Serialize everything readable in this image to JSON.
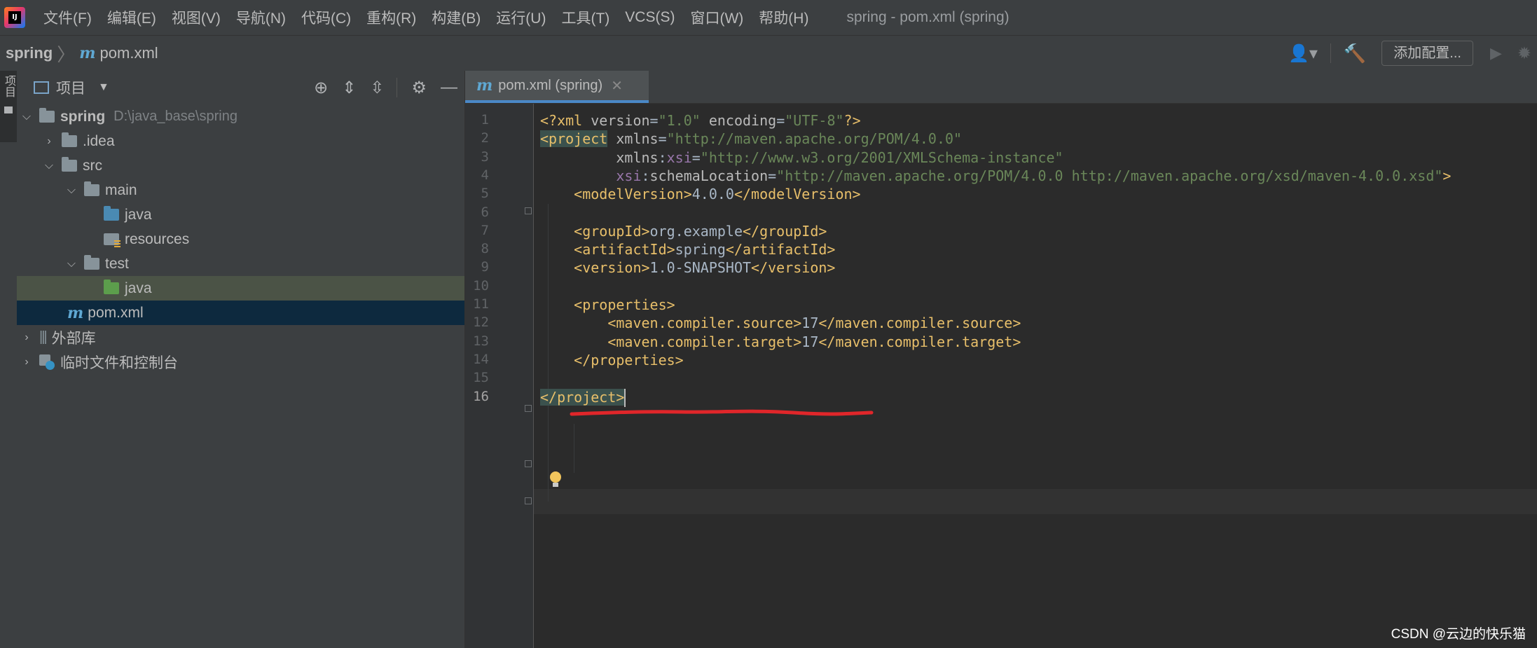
{
  "menubar": {
    "items": [
      "文件(F)",
      "编辑(E)",
      "视图(V)",
      "导航(N)",
      "代码(C)",
      "重构(R)",
      "构建(B)",
      "运行(U)",
      "工具(T)",
      "VCS(S)",
      "窗口(W)",
      "帮助(H)"
    ],
    "window_title": "spring - pom.xml (spring)"
  },
  "navbar": {
    "project": "spring",
    "file": "pom.xml",
    "add_config_label": "添加配置..."
  },
  "tool_strip": {
    "project_tab": "项目"
  },
  "project_panel": {
    "title": "项目",
    "tree": [
      {
        "label": "spring",
        "hint": "D:\\java_base\\spring",
        "depth": 0,
        "expanded": true,
        "icon": "module-folder-icon"
      },
      {
        "label": ".idea",
        "depth": 1,
        "expanded": false,
        "icon": "folder-icon"
      },
      {
        "label": "src",
        "depth": 1,
        "expanded": true,
        "icon": "folder-icon"
      },
      {
        "label": "main",
        "depth": 2,
        "expanded": true,
        "icon": "folder-icon"
      },
      {
        "label": "java",
        "depth": 3,
        "icon": "source-folder-icon"
      },
      {
        "label": "resources",
        "depth": 3,
        "icon": "resources-folder-icon"
      },
      {
        "label": "test",
        "depth": 2,
        "expanded": true,
        "icon": "folder-icon"
      },
      {
        "label": "java",
        "depth": 3,
        "icon": "test-folder-icon",
        "state": "highlighted"
      },
      {
        "label": "pom.xml",
        "depth": 1,
        "icon": "maven-file-icon",
        "state": "selected"
      },
      {
        "label": "外部库",
        "depth": 0,
        "expanded": false,
        "icon": "library-icon"
      },
      {
        "label": "临时文件和控制台",
        "depth": 0,
        "expanded": false,
        "icon": "scratch-icon"
      }
    ]
  },
  "editor": {
    "tab_label": "pom.xml (spring)",
    "current_line": 16,
    "lines": [
      {
        "n": "1",
        "parts": [
          [
            "tag",
            "<?"
          ],
          [
            "tag",
            "xml"
          ],
          [
            "attr",
            " version"
          ],
          [
            "txt",
            "="
          ],
          [
            "str",
            "\"1.0\""
          ],
          [
            "attr",
            " encoding"
          ],
          [
            "txt",
            "="
          ],
          [
            "str",
            "\"UTF-8\""
          ],
          [
            "tag",
            "?>"
          ]
        ]
      },
      {
        "n": "2",
        "parts": [
          [
            "tag hl",
            "<project"
          ],
          [
            "attr",
            " xmlns"
          ],
          [
            "txt",
            "="
          ],
          [
            "str",
            "\"http://maven.apache.org/POM/4.0.0\""
          ]
        ]
      },
      {
        "n": "3",
        "parts": [
          [
            "attr",
            "         xmlns"
          ],
          [
            "txt",
            ":"
          ],
          [
            "ns",
            "xsi"
          ],
          [
            "txt",
            "="
          ],
          [
            "str",
            "\"http://www.w3.org/2001/XMLSchema-instance\""
          ]
        ]
      },
      {
        "n": "4",
        "parts": [
          [
            "ns",
            "         xsi"
          ],
          [
            "txt",
            ":"
          ],
          [
            "attr",
            "schemaLocation"
          ],
          [
            "txt",
            "="
          ],
          [
            "str",
            "\"http://maven.apache.org/POM/4.0.0 http://maven.apache.org/xsd/maven-4.0.0.xsd\""
          ],
          [
            "tag",
            ">"
          ]
        ]
      },
      {
        "n": "5",
        "parts": [
          [
            "tag",
            "    <modelVersion>"
          ],
          [
            "txt",
            "4.0.0"
          ],
          [
            "tag",
            "</modelVersion>"
          ]
        ]
      },
      {
        "n": "6",
        "parts": [
          [
            "txt",
            ""
          ]
        ]
      },
      {
        "n": "7",
        "parts": [
          [
            "tag",
            "    <groupId>"
          ],
          [
            "txt",
            "org.example"
          ],
          [
            "tag",
            "</groupId>"
          ]
        ]
      },
      {
        "n": "8",
        "parts": [
          [
            "tag",
            "    <artifactId>"
          ],
          [
            "txt",
            "spring"
          ],
          [
            "tag",
            "</artifactId>"
          ]
        ]
      },
      {
        "n": "9",
        "parts": [
          [
            "tag",
            "    <version>"
          ],
          [
            "txt",
            "1.0-SNAPSHOT"
          ],
          [
            "tag",
            "</version>"
          ]
        ]
      },
      {
        "n": "10",
        "parts": [
          [
            "txt",
            ""
          ]
        ]
      },
      {
        "n": "11",
        "parts": [
          [
            "tag",
            "    <properties>"
          ]
        ]
      },
      {
        "n": "12",
        "parts": [
          [
            "tag",
            "        <maven.compiler.source>"
          ],
          [
            "txt",
            "17"
          ],
          [
            "tag",
            "</maven.compiler.source>"
          ]
        ]
      },
      {
        "n": "13",
        "parts": [
          [
            "tag",
            "        <maven.compiler.target>"
          ],
          [
            "txt",
            "17"
          ],
          [
            "tag",
            "</maven.compiler.target>"
          ]
        ]
      },
      {
        "n": "14",
        "parts": [
          [
            "tag",
            "    </properties>"
          ]
        ]
      },
      {
        "n": "15",
        "parts": [
          [
            "txt",
            ""
          ]
        ]
      },
      {
        "n": "16",
        "parts": [
          [
            "tag hl",
            "</project>"
          ]
        ]
      }
    ]
  },
  "watermark": "CSDN @云边的快乐猫",
  "colors": {
    "tag": "#e8bf6a",
    "string": "#6a8759",
    "namespace": "#9876aa",
    "annotation_red": "#e0262a"
  }
}
